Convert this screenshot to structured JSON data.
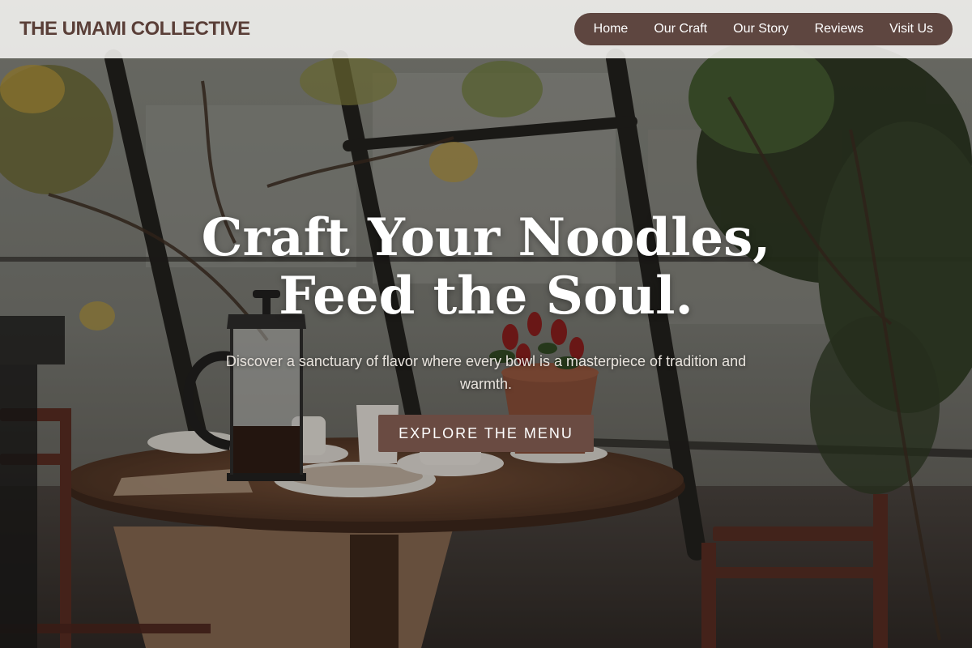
{
  "header": {
    "brand": "THE UMAMI COLLECTIVE",
    "nav": [
      {
        "label": "Home"
      },
      {
        "label": "Our Craft"
      },
      {
        "label": "Our Story"
      },
      {
        "label": "Reviews"
      },
      {
        "label": "Visit Us"
      }
    ]
  },
  "hero": {
    "headline_line1": "Craft Your Noodles,",
    "headline_line2": "Feed the Soul.",
    "tagline": "Discover a sanctuary of flavor where every bowl is a masterpiece of tradition and warmth.",
    "cta_label": "EXPLORE THE MENU"
  },
  "colors": {
    "brand_text": "#5a3f38",
    "nav_pill": "#5e4640",
    "cta_background": "#6a4b42"
  }
}
